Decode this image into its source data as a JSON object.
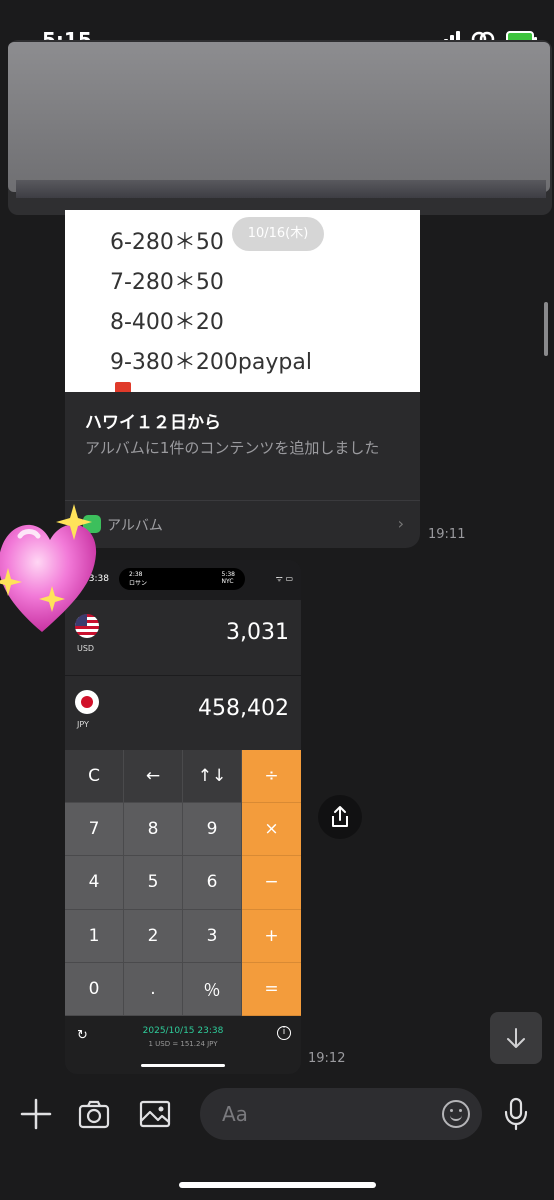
{
  "status_bar": {
    "time": "5:15"
  },
  "date_separator": "10/16(木)",
  "album_card": {
    "image_lines": [
      "6-280＊50",
      "7-280＊50",
      "8-400＊20",
      "9-380＊200paypal"
    ],
    "title": "ハワイ１２日から",
    "description": "アルバムに1件のコンテンツを追加しました",
    "footer_label": "アルバム",
    "timestamp": "19:11"
  },
  "calculator_screenshot": {
    "status_time": "23:38",
    "island_left_time": "2:38",
    "island_left_label": "ロサン",
    "island_right_time": "5:38",
    "island_right_label": "NYC",
    "currency_1": {
      "code": "USD",
      "value": "3,031"
    },
    "currency_2": {
      "code": "JPY",
      "value": "458,402"
    },
    "keys": [
      "C",
      "←",
      "↑↓",
      "÷",
      "7",
      "8",
      "9",
      "×",
      "4",
      "5",
      "6",
      "−",
      "1",
      "2",
      "3",
      "+",
      "0",
      ".",
      "％",
      "="
    ],
    "footer_date": "2025/10/15 23:38",
    "footer_rate": "1 USD = 151.24 JPY",
    "timestamp": "19:12"
  },
  "input": {
    "placeholder": "Aa"
  },
  "colors": {
    "accent_orange": "#f39c3c",
    "background": "#1b1b1c",
    "rate_green": "#2ecc9a"
  }
}
